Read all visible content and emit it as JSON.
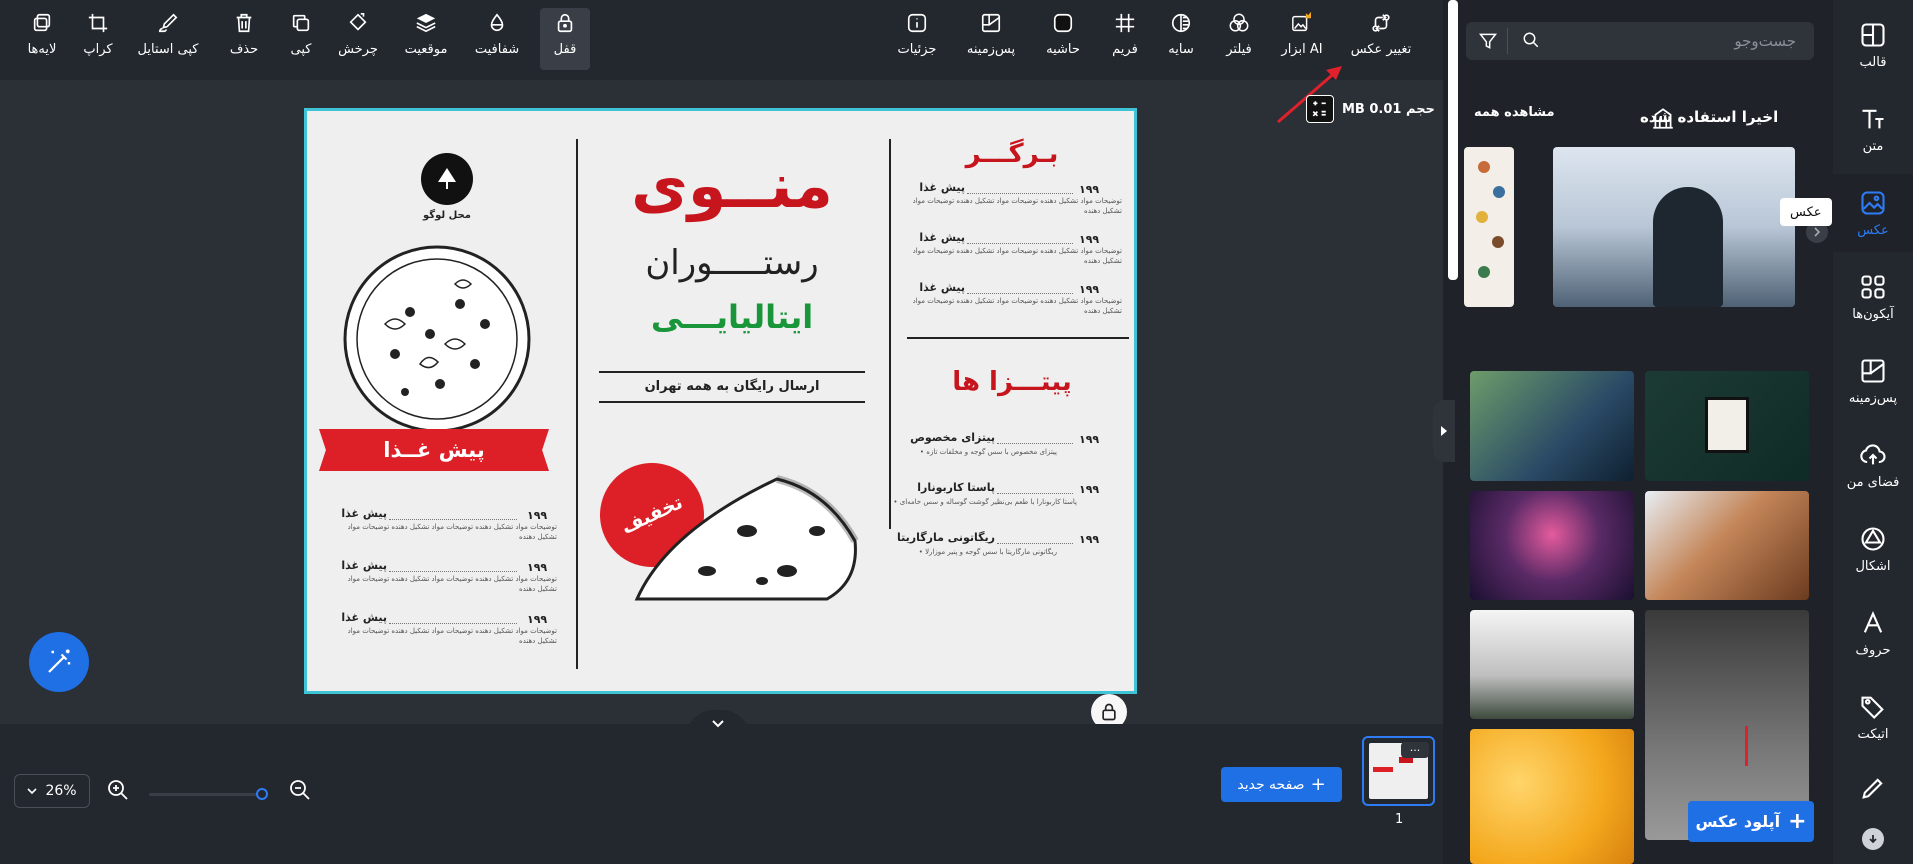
{
  "toolbar": {
    "left_tools": [
      {
        "label": "لایه‌ها",
        "icon": "layers-icon"
      },
      {
        "label": "کراپ",
        "icon": "crop-icon"
      },
      {
        "label": "کپی استایل",
        "icon": "brush-icon"
      },
      {
        "label": "حذف",
        "icon": "trash-icon"
      },
      {
        "label": "کپی",
        "icon": "copy-icon"
      },
      {
        "label": "چرخش",
        "icon": "rotate-icon"
      },
      {
        "label": "موقعیت",
        "icon": "stack-icon"
      },
      {
        "label": "شفافیت",
        "icon": "drop-icon"
      },
      {
        "label": "قفل",
        "icon": "lock-icon"
      }
    ],
    "right_tools": [
      {
        "label": "جزئیات",
        "icon": "info-icon"
      },
      {
        "label": "پس‌زمینه",
        "icon": "background-icon"
      },
      {
        "label": "حاشیه",
        "icon": "border-icon"
      },
      {
        "label": "فریم",
        "icon": "frame-icon"
      },
      {
        "label": "سایه",
        "icon": "shadow-icon"
      },
      {
        "label": "فیلتر",
        "icon": "filter-circles-icon"
      },
      {
        "label": "ابزار AI",
        "icon": "ai-image-icon"
      },
      {
        "label": "تغییر عکس",
        "icon": "swap-image-icon"
      }
    ]
  },
  "canvas": {
    "size_label": "حجم 0.01 MB",
    "menu": {
      "logo_label": "محل لوگو",
      "title_main": "منــوی",
      "title_restaurant": "رستـــــوران",
      "title_italian": "ایتالیایـــی",
      "free_delivery": "ارسال رایگان به همه تهران",
      "discount": "تخفیف",
      "appetizer_banner": "پیش غــذا",
      "burger_title": "بـرگـــر",
      "pizza_title": "پیتـــزا ها",
      "burger_items": [
        {
          "name": "پیش غذا",
          "price": "۱۹۹",
          "desc": "توضیحات مواد تشکیل دهنده توضیحات مواد تشکیل دهنده توضیحات مواد تشکیل دهنده"
        },
        {
          "name": "پیش غذا",
          "price": "۱۹۹",
          "desc": "توضیحات مواد تشکیل دهنده توضیحات مواد تشکیل دهنده توضیحات مواد تشکیل دهنده"
        },
        {
          "name": "پیش غذا",
          "price": "۱۹۹",
          "desc": "توضیحات مواد تشکیل دهنده توضیحات مواد تشکیل دهنده توضیحات مواد تشکیل دهنده"
        }
      ],
      "pizza_items": [
        {
          "name": "پیتزای مخصوص",
          "price": "۱۹۹",
          "desc": "• پیتزای مخصوص با سس گوجه و مخلفات تازه"
        },
        {
          "name": "پاستا کاربونارا",
          "price": "۱۹۹",
          "desc": "• پاستا کاربونارا با طعم بی‌نظیر گوشت گوساله و سس خامه‌ای"
        },
        {
          "name": "ریگاتونی مارگاریتا",
          "price": "۱۹۹",
          "desc": "• ریگاتونی مارگاریتا با سس گوجه و پنیر موزارلا"
        }
      ],
      "appetizer_items": [
        {
          "name": "پیش غذا",
          "price": "۱۹۹",
          "desc": "توضیحات مواد تشکیل دهنده توضیحات مواد تشکیل دهنده توضیحات مواد تشکیل دهنده"
        },
        {
          "name": "پیش غذا",
          "price": "۱۹۹",
          "desc": "توضیحات مواد تشکیل دهنده توضیحات مواد تشکیل دهنده توضیحات مواد تشکیل دهنده"
        },
        {
          "name": "پیش غذا",
          "price": "۱۹۹",
          "desc": "توضیحات مواد تشکیل دهنده توضیحات مواد تشکیل دهنده توضیحات مواد تشکیل دهنده"
        }
      ]
    }
  },
  "bottom": {
    "zoom": "26%",
    "new_page": "صفحه جدید",
    "page_number": "1",
    "more": "···"
  },
  "panel": {
    "search_placeholder": "جست‌وجو",
    "recent_title": "اخیرا استفاده شده",
    "view_all": "مشاهده همه",
    "upload": "آپلود عکس"
  },
  "rail": {
    "items": [
      {
        "label": "قالب",
        "icon": "template-icon"
      },
      {
        "label": "متن",
        "icon": "text-icon"
      },
      {
        "label": "عکس",
        "icon": "image-icon"
      },
      {
        "label": "آیکون‌ها",
        "icon": "grid-icon"
      },
      {
        "label": "پس‌زمینه",
        "icon": "background-icon"
      },
      {
        "label": "فضای من",
        "icon": "cloud-upload-icon"
      },
      {
        "label": "اشکال",
        "icon": "shapes-icon"
      },
      {
        "label": "حروف",
        "icon": "font-icon"
      },
      {
        "label": "اتیکت",
        "icon": "sticker-icon"
      }
    ],
    "tooltip": "عکس"
  },
  "colors": {
    "accent": "#1f6fe5",
    "selection": "#3ec4d6",
    "menu_red": "#c7151e",
    "menu_green": "#19963a"
  }
}
